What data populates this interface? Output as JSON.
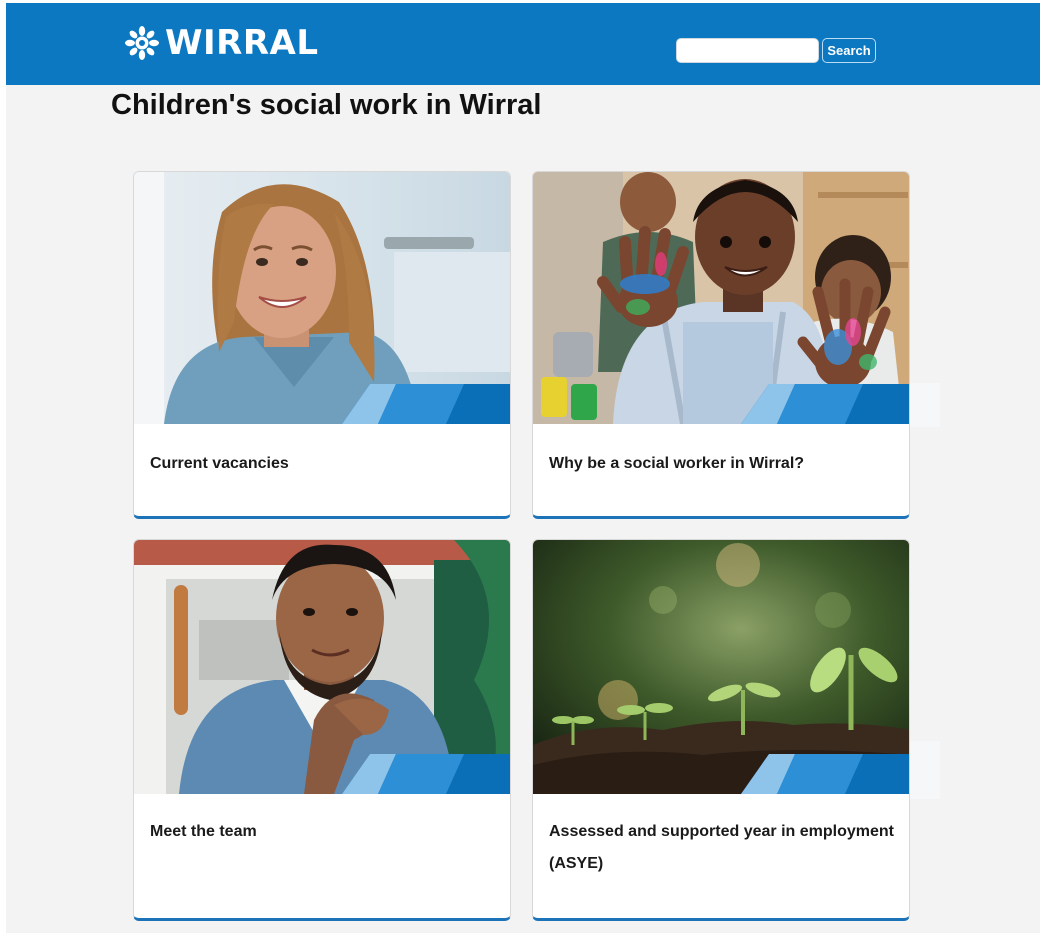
{
  "header": {
    "logo_text": "WIRRAL",
    "search": {
      "placeholder": "",
      "value": "",
      "button_label": "Search"
    },
    "brand_color": "#0b78c1"
  },
  "page_title": "Children's social work in Wirral",
  "cards": [
    {
      "title": "Current vacancies",
      "image": "woman-smiling-photo"
    },
    {
      "title": "Why be a social worker in Wirral?",
      "image": "child-painted-hands-photo"
    },
    {
      "title": "Meet the team",
      "image": "man-denim-jacket-photo"
    },
    {
      "title": "Assessed and supported year in employment (ASYE)",
      "image": "seedlings-in-soil-photo"
    }
  ],
  "colors": {
    "card_accent": "#1d73b8",
    "banner_light": "#8ec3ea",
    "banner_mid": "#2d8fd5",
    "banner_dark": "#0b6fb8"
  }
}
